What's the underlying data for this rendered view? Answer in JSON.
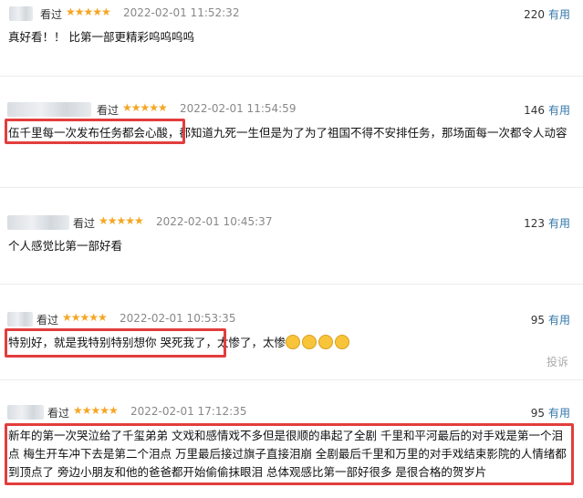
{
  "reviews": [
    {
      "status": "看过",
      "stars": "★★★★★",
      "time": "2022-02-01 11:52:32",
      "count": "220",
      "useful": "有用",
      "text": "真好看！！ 比第一部更精彩呜呜呜呜"
    },
    {
      "status": "看过",
      "stars": "★★★★★",
      "time": "2022-02-01 11:54:59",
      "count": "146",
      "useful": "有用",
      "text_a": "伍千里每一次发布任务都会心酸，",
      "text_b": "都知道九死一生但是为了为了祖国不得不安排任务，那场面每一次都令人动容"
    },
    {
      "status": "看过",
      "stars": "★★★★★",
      "time": "2022-02-01 10:45:37",
      "count": "123",
      "useful": "有用",
      "text": "个人感觉比第一部好看"
    },
    {
      "status": "看过",
      "stars": "★★★★★",
      "time": "2022-02-01 10:53:35",
      "count": "95",
      "useful": "有用",
      "text_a": "特别好，就是我特别特别想你 哭死我了，",
      "text_b": "太惨了，太惨",
      "report": "投诉"
    },
    {
      "status": "看过",
      "stars": "★★★★★",
      "time": "2022-02-01 17:12:35",
      "count": "95",
      "useful": "有用",
      "text": "新年的第一次哭泣给了千玺弟弟 文戏和感情戏不多但是很顺的串起了全剧 千里和平河最后的对手戏是第一个泪点 梅生开车冲下去是第二个泪点 万里最后接过旗子直接泪崩 全剧最后千里和万里的对手戏结束影院的人情绪都到顶点了 旁边小朋友和他的爸爸都开始偷偷抹眼泪 总体观感比第一部好很多 是很合格的贺岁片"
    }
  ],
  "colors": {
    "star": "#f5a623",
    "useful": "#3377aa",
    "highlight": "#e23d3d"
  },
  "icons": {
    "emoji": "crying-face-icon"
  }
}
